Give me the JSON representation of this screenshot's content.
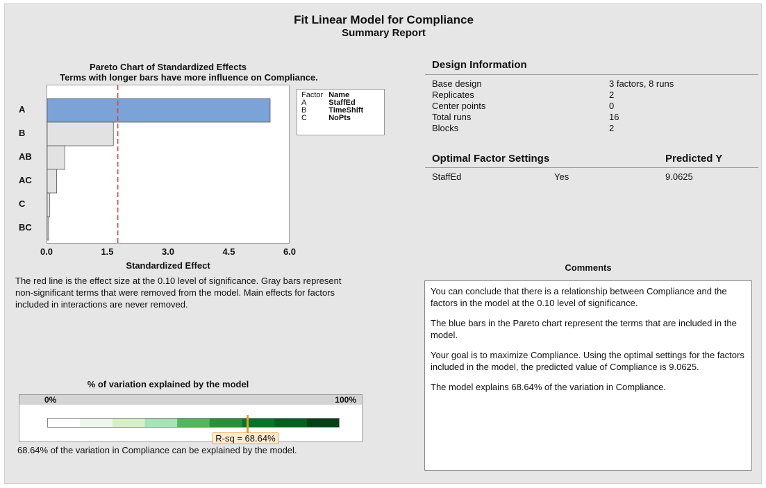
{
  "report": {
    "title": "Fit Linear Model for Compliance",
    "subtitle": "Summary Report"
  },
  "pareto": {
    "title": "Pareto Chart of Standardized Effects",
    "subtitle": "Terms with longer bars have more influence on Compliance.",
    "xlabel": "Standardized Effect",
    "note": "The red line is the effect size at the 0.10 level of significance. Gray bars represent non-significant terms that were removed from the model. Main effects for factors included in interactions are never removed.",
    "legend": {
      "headers": [
        "Factor",
        "Name"
      ],
      "rows": [
        [
          "A",
          "StaffEd"
        ],
        [
          "B",
          "TimeShift"
        ],
        [
          "C",
          "NoPts"
        ]
      ]
    }
  },
  "chart_data": [
    {
      "type": "bar",
      "orientation": "horizontal",
      "title": "Pareto Chart of Standardized Effects",
      "subtitle": "Terms with longer bars have more influence on Compliance.",
      "xlabel": "Standardized Effect",
      "categories": [
        "A",
        "B",
        "AB",
        "AC",
        "C",
        "BC"
      ],
      "values": [
        5.52,
        1.65,
        0.45,
        0.25,
        0.08,
        0.05
      ],
      "significant": [
        true,
        false,
        false,
        false,
        false,
        false
      ],
      "bar_colors": [
        "#7ba3d8",
        "#e2e2e2",
        "#e2e2e2",
        "#e2e2e2",
        "#e2e2e2",
        "#e2e2e2"
      ],
      "reference_line": {
        "value": 1.76,
        "color": "#d9403b",
        "style": "dashed"
      },
      "xlim": [
        0,
        6.0
      ],
      "xticks": [
        "0.0",
        "1.5",
        "3.0",
        "4.5",
        "6.0"
      ],
      "grid": false
    },
    {
      "type": "gauge",
      "title": "% of variation explained by the model",
      "value": 68.64,
      "range": [
        0,
        100
      ],
      "tick_labels": [
        "0%",
        "100%"
      ],
      "marker_label": "R-sq = 68.64%",
      "band_colors": [
        "#ffffff",
        "#eef7ec",
        "#d7f0c6",
        "#a8e2b6",
        "#54b45f",
        "#2a8f3a",
        "#08742a",
        "#04601f",
        "#034116"
      ]
    }
  ],
  "variation": {
    "title": "% of variation explained by the model",
    "tick_min": "0%",
    "tick_max": "100%",
    "marker_label": "R-sq = 68.64%",
    "caption": "68.64% of the variation in Compliance can be explained by the model."
  },
  "design": {
    "header": "Design Information",
    "rows": [
      {
        "label": "Base design",
        "value": "3 factors, 8 runs"
      },
      {
        "label": "Replicates",
        "value": "2"
      },
      {
        "label": "Center points",
        "value": "0"
      },
      {
        "label": "Total runs",
        "value": "16"
      },
      {
        "label": "Blocks",
        "value": "2"
      }
    ]
  },
  "optimal": {
    "header": "Optimal Factor Settings",
    "predicted_header": "Predicted Y",
    "rows": [
      {
        "factor": "StaffEd",
        "setting": "Yes",
        "predicted": "9.0625"
      }
    ]
  },
  "comments": {
    "header": "Comments",
    "paragraphs": [
      "You can conclude that there is a relationship between Compliance and the factors in the model at the 0.10 level of significance.",
      "The blue bars in the Pareto chart represent the terms that are included in the model.",
      "Your goal is to maximize Compliance. Using the optimal settings for the factors included in the model, the predicted value of Compliance is 9.0625.",
      "The model explains 68.64% of the variation in Compliance."
    ]
  },
  "colors": {
    "panel_bg": "#e6e6e6",
    "significant_bar": "#7ba3d8",
    "nonsignificant_bar": "#e2e2e2",
    "reference_line": "#d9403b",
    "marker": "#e8a020"
  }
}
